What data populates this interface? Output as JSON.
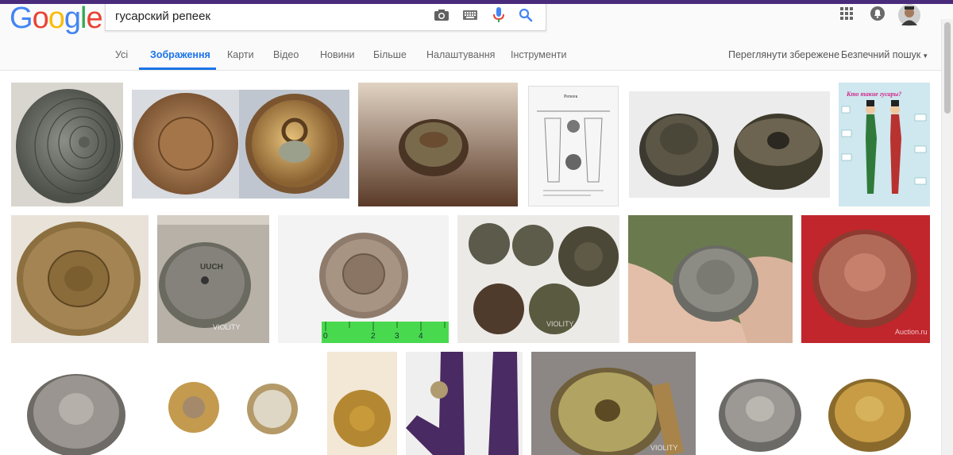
{
  "logo": {
    "letters": [
      "G",
      "o",
      "o",
      "g",
      "l",
      "e"
    ],
    "colors": [
      "#4285f4",
      "#ea4335",
      "#fbbc05",
      "#4285f4",
      "#34a853",
      "#ea4335"
    ]
  },
  "search": {
    "query": "гусарский репеек",
    "icons": [
      "camera-icon",
      "keyboard-icon",
      "microphone-icon",
      "search-icon"
    ]
  },
  "header_right": {
    "icons": [
      "apps-grid-icon",
      "notifications-icon",
      "account-avatar"
    ]
  },
  "tabs": [
    "Усі",
    "Зображення",
    "Карти",
    "Відео",
    "Новини",
    "Більше",
    "Налаштування",
    "Інструменти"
  ],
  "active_tab": "Зображення",
  "tools_right": {
    "saved": "Переглянути збережене",
    "safe_search": "Безпечний пошук"
  },
  "results": {
    "watermarks": [
      "VIOLITY",
      "VIOLITY",
      "Auction.ru",
      "VIOLITY"
    ],
    "poster_title": "Кто такие гусары?",
    "doc_title": "Репеек",
    "ruler_digits": [
      "0",
      "2",
      "3",
      "4"
    ],
    "button_text": [
      "UUCH"
    ]
  },
  "colors": {
    "accent": "#1a73e8",
    "topstrip": "#4a2a7a"
  }
}
